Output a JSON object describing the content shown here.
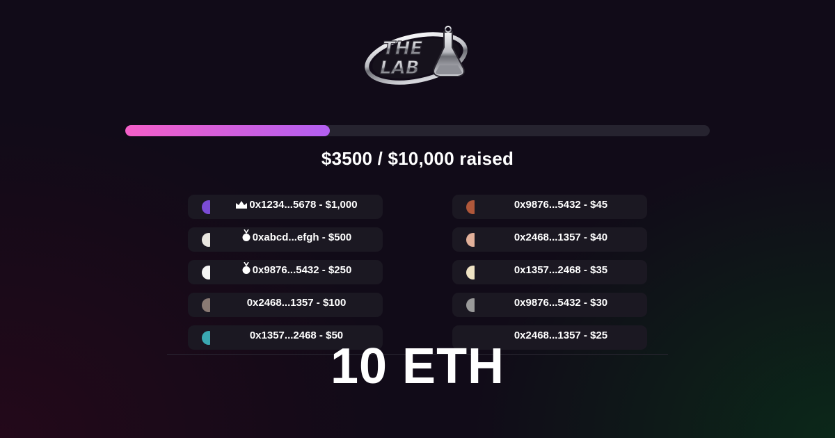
{
  "brand": {
    "logo_text_line1": "THE",
    "logo_text_line2": "LAB",
    "icon": "flask-icon"
  },
  "campaign": {
    "progress_fraction": 0.35,
    "raised_text": "$3500 / $10,000 raised",
    "total": "10 ETH",
    "colors": {
      "progress_start": "#f45fc8",
      "progress_end": "#b25ff0",
      "track": "#26232f"
    }
  },
  "donors": {
    "left": [
      {
        "label": "0x1234...5678 - $1,000",
        "badge": "crown-icon",
        "avatar_color": "#7b4bd6"
      },
      {
        "label": "0xabcd...efgh - $500",
        "badge": "medal-icon",
        "avatar_color": "#e9e6e0"
      },
      {
        "label": "0x9876...5432 - $250",
        "badge": "medal-icon",
        "avatar_color": "#f4f4f4"
      },
      {
        "label": "0x2468...1357 - $100",
        "badge": "",
        "avatar_color": "#8a7a74"
      },
      {
        "label": "0x1357...2468 - $50",
        "badge": "",
        "avatar_color": "#3aa9b2"
      }
    ],
    "right": [
      {
        "label": "0x9876...5432 - $45",
        "avatar_color": "#b0573a"
      },
      {
        "label": "0x2468...1357 - $40",
        "avatar_color": "#e2b09a"
      },
      {
        "label": "0x1357...2468 - $35",
        "avatar_color": "#efe3c4"
      },
      {
        "label": "0x9876...5432 - $30",
        "avatar_color": "#9a9a9a"
      },
      {
        "label": "0x2468...1357 - $25",
        "avatar_color": ""
      }
    ]
  }
}
